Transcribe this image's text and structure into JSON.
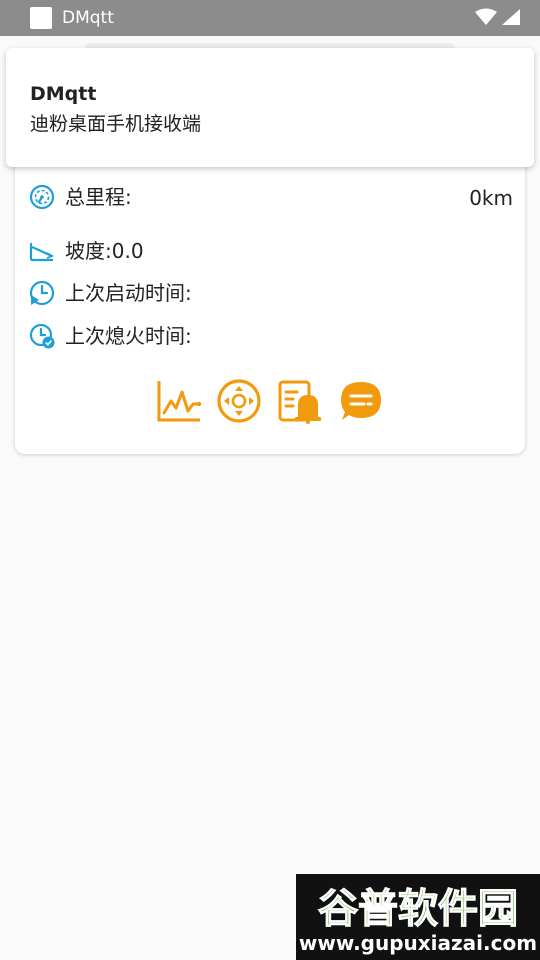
{
  "status_bar": {
    "app_name": "DMqtt"
  },
  "notification": {
    "title": "DMqtt",
    "body": "迪粉桌面手机接收端"
  },
  "card": {
    "mileage_label": "总里程:",
    "mileage_value": "0km",
    "slope_label": "坡度:",
    "slope_value": "0.0",
    "last_start_label": "上次启动时间:",
    "last_start_value": "",
    "last_stop_label": "上次熄火时间:",
    "last_stop_value": ""
  },
  "actions": [
    {
      "name": "chart",
      "icon": "line-chart-icon"
    },
    {
      "name": "direction",
      "icon": "direction-pad-icon"
    },
    {
      "name": "alarm",
      "icon": "alarm-bell-icon"
    },
    {
      "name": "message",
      "icon": "chat-bubble-icon"
    }
  ],
  "watermark": {
    "brand": "谷普软件园",
    "url": "www.gupuxiazai.com"
  },
  "colors": {
    "status_bar": "#8c8c8c",
    "accent_blue": "#1e9fd8",
    "accent_orange": "#f29a0e",
    "background": "#fafafa"
  }
}
